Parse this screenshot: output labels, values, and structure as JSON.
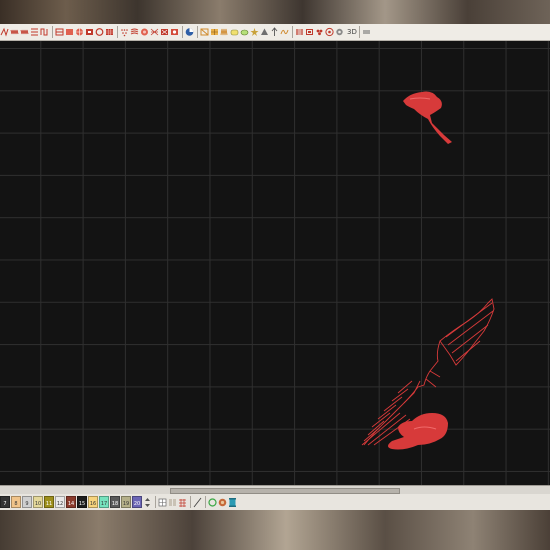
{
  "toolbar": {
    "icons": [
      "line-run-icon",
      "zigzag-run-icon",
      "satin-column-icon",
      "fill-stitch-icon",
      "motif-fill-icon",
      "ring-icon",
      "circle-icon",
      "grid-fill-icon",
      "bead-icon",
      "wave-fill-icon",
      "radial-fill-icon",
      "spiral-fill-icon",
      "contour-fill-icon",
      "cross-stitch-icon",
      "net-fill-icon",
      "pattern-fill-icon",
      "color-wheel-icon",
      "hatch-fill-icon",
      "gradient-fill-icon",
      "column-a-icon",
      "column-b-icon",
      "star-icon",
      "triangle-icon",
      "arrow-up-icon",
      "fan-fill-icon",
      "shape-fill-icon",
      "wave-icon",
      "lace-icon",
      "applique-icon",
      "flower-icon",
      "palette-icon"
    ],
    "view_3d_label": "3D"
  },
  "palette": {
    "swatches": [
      {
        "label": "7",
        "color": "#333333"
      },
      {
        "label": "8",
        "color": "#f1c48a"
      },
      {
        "label": "9",
        "color": "#cfcfcf"
      },
      {
        "label": "10",
        "color": "#e4d89a"
      },
      {
        "label": "11",
        "color": "#9d8f1c"
      },
      {
        "label": "12",
        "color": "#e9e9e9"
      },
      {
        "label": "14",
        "color": "#8b3a2b"
      },
      {
        "label": "15",
        "color": "#1c1c1c"
      },
      {
        "label": "16",
        "color": "#f6d37c"
      },
      {
        "label": "17",
        "color": "#75e2bd"
      },
      {
        "label": "18",
        "color": "#5a5a5a"
      },
      {
        "label": "19",
        "color": "#b5b089"
      },
      {
        "label": "20",
        "color": "#6b65b5"
      }
    ],
    "tools": [
      "arrow-updown-icon",
      "grid-view-icon",
      "columns-view-icon",
      "line-tool-icon",
      "dashed-line-icon",
      "color-cycle-icon",
      "globe-icon",
      "spool-icon"
    ]
  }
}
